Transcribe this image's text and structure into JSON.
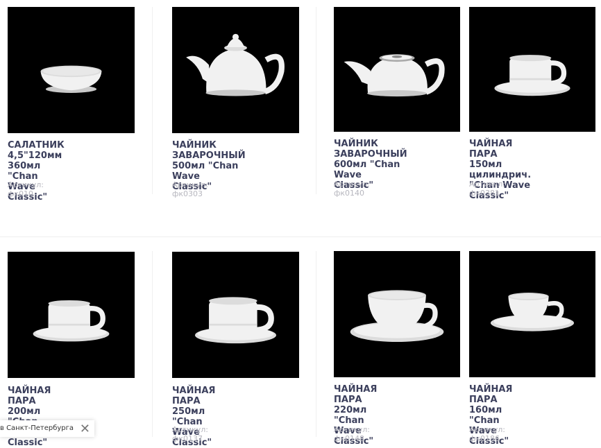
{
  "products": [
    {
      "title": "САЛАТНИК 4,5\"120мм\n360мл \"Chan Wave\nClassic\"",
      "sku": "Артикул: фк010",
      "image": "bowl"
    },
    {
      "title": "ЧАЙНИК ЗАВАРОЧНЫЙ\n500мл \"Chan Wave\nClassic\"",
      "sku": "Артикул: фк0303",
      "image": "teapot-round"
    },
    {
      "title": "ЧАЙНИК ЗАВАРОЧНЫЙ\n600мл \"Chan Wave\nClassic\"",
      "sku": "Артикул: фк0140",
      "image": "teapot-flat"
    },
    {
      "title": "ЧАЙНАЯ ПАРА 150мл\nцилиндрич. \"Chan Wave\nClassic\"",
      "sku": "Артикул: фк0381",
      "image": "cup-cylinder"
    },
    {
      "title": "ЧАЙНАЯ ПАРА 200мл\n\"Chan Wave Classic\"",
      "sku": "",
      "image": "cup-cylinder"
    },
    {
      "title": "ЧАЙНАЯ ПАРА 250мл\n\"Chan Wave Classic\"",
      "sku": "Артикул: фк0137",
      "image": "cup-cylinder-large"
    },
    {
      "title": "ЧАЙНАЯ ПАРА 220мл\n\"Chan Wave Classic\"",
      "sku": "Артикул: фк0148",
      "image": "cup-tulip"
    },
    {
      "title": "ЧАЙНАЯ ПАРА 160мл\n\"Chan Wave Classic\"",
      "sku": "Артикул: фк0186",
      "image": "cup-tulip-small"
    }
  ],
  "location_popup": {
    "text": "в Санкт-Петербурга",
    "close_symbol": "✕"
  },
  "colors": {
    "title": "#3b3f5c",
    "sku": "#b6b6be",
    "photo_bg": "#000000",
    "porcelain": "#f2f2f2"
  }
}
